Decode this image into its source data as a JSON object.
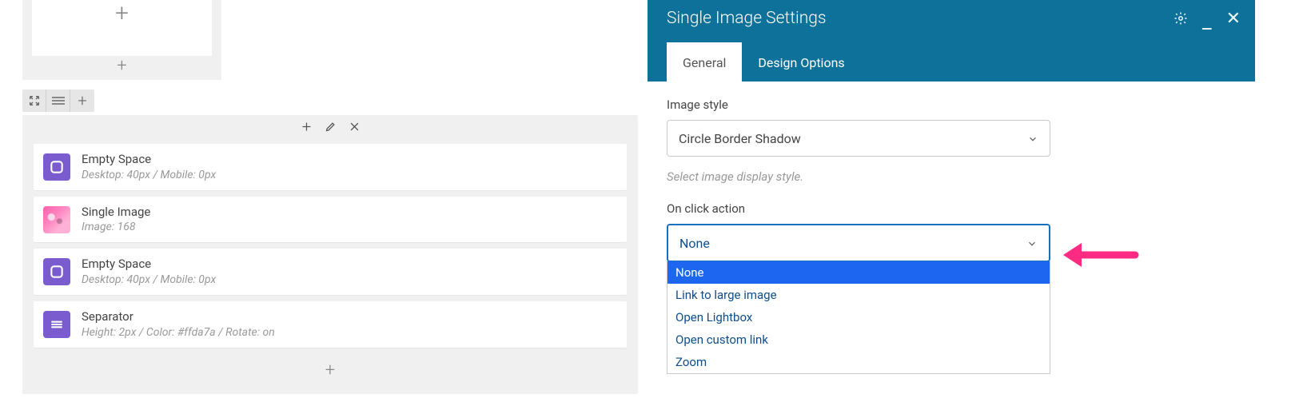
{
  "builder": {
    "elements": [
      {
        "title": "Empty Space",
        "meta": "Desktop: 40px  /  Mobile: 0px",
        "icon": "square"
      },
      {
        "title": "Single Image",
        "meta": "Image: 168",
        "icon": "thumb"
      },
      {
        "title": "Empty Space",
        "meta": "Desktop: 40px  /  Mobile: 0px",
        "icon": "square"
      },
      {
        "title": "Separator",
        "meta": "Height: 2px  /  Color: #ffda7a  /  Rotate: on",
        "icon": "lines"
      }
    ]
  },
  "panel": {
    "title": "Single Image Settings",
    "tabs": {
      "general": "General",
      "design": "Design Options"
    },
    "image_style": {
      "label": "Image style",
      "value": "Circle Border Shadow",
      "helper": "Select image display style."
    },
    "on_click": {
      "label": "On click action",
      "value": "None",
      "options": [
        "None",
        "Link to large image",
        "Open Lightbox",
        "Open custom link",
        "Zoom"
      ]
    }
  }
}
